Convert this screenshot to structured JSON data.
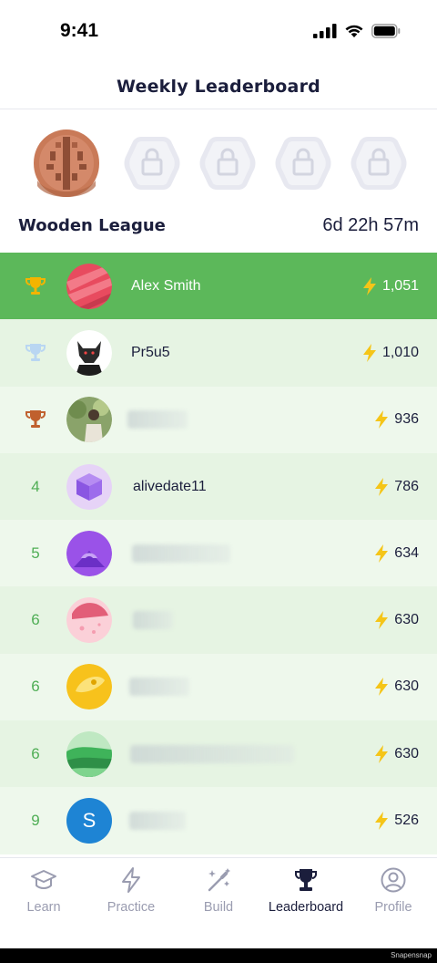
{
  "status_bar": {
    "time": "9:41"
  },
  "header": {
    "title": "Weekly Leaderboard"
  },
  "league": {
    "name": "Wooden League",
    "timer": "6d 22h 57m"
  },
  "colors": {
    "highlight": "#5cb85a",
    "rank_text": "#4fae55",
    "bolt": "#f5c518",
    "active_nav": "#1b1e3c",
    "inactive_nav": "#9a9cb0"
  },
  "leaderboard": [
    {
      "rank": "",
      "rank_icon": "gold-trophy-icon",
      "name": "Alex Smith",
      "score": "1,051",
      "avatar": "red-planet-avatar"
    },
    {
      "rank": "",
      "rank_icon": "silver-trophy-icon",
      "name": "Pr5u5",
      "score": "1,010",
      "avatar": "wolf-avatar"
    },
    {
      "rank": "",
      "rank_icon": "bronze-trophy-icon",
      "name": "",
      "score": "936",
      "avatar": "photo-avatar"
    },
    {
      "rank": "4",
      "name": "alivedate11",
      "score": "786",
      "avatar": "purple-cube-avatar"
    },
    {
      "rank": "5",
      "name": "",
      "score": "634",
      "avatar": "purple-mountain-avatar"
    },
    {
      "rank": "6",
      "name": "",
      "score": "630",
      "avatar": "pink-planet-avatar"
    },
    {
      "rank": "6",
      "name": "",
      "score": "630",
      "avatar": "yellow-planet-avatar"
    },
    {
      "rank": "6",
      "name": "",
      "score": "630",
      "avatar": "green-hills-avatar"
    },
    {
      "rank": "9",
      "name": "",
      "score": "526",
      "avatar": "blue-letter-avatar",
      "avatar_letter": "S"
    }
  ],
  "nav": [
    {
      "label": "Learn",
      "icon": "graduation-cap-icon",
      "active": false
    },
    {
      "label": "Practice",
      "icon": "lightning-icon",
      "active": false
    },
    {
      "label": "Build",
      "icon": "magic-wand-icon",
      "active": false
    },
    {
      "label": "Leaderboard",
      "icon": "trophy-icon",
      "active": true
    },
    {
      "label": "Profile",
      "icon": "user-circle-icon",
      "active": false
    }
  ],
  "watermark": "Snapensnap"
}
